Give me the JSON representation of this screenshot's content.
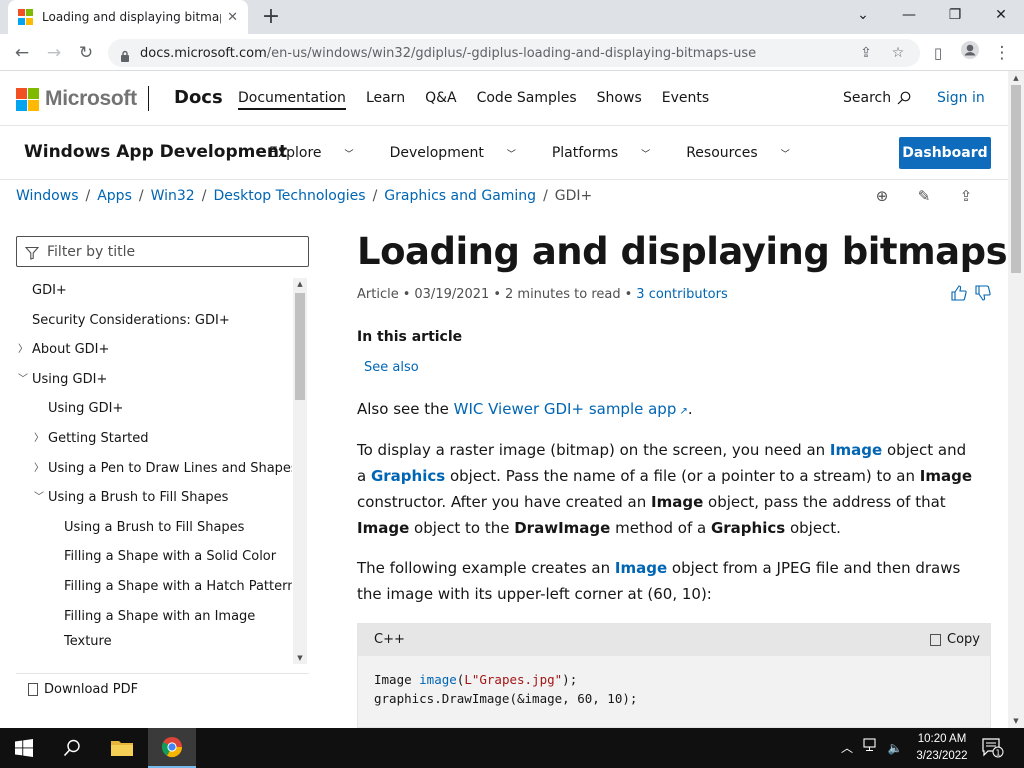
{
  "browser": {
    "tab_title": "Loading and displaying bitmaps",
    "url_host": "docs.microsoft.com",
    "url_path": "/en-us/windows/win32/gdiplus/-gdiplus-loading-and-displaying-bitmaps-use"
  },
  "header": {
    "brand": "Microsoft",
    "site": "Docs",
    "nav": [
      "Documentation",
      "Learn",
      "Q&A",
      "Code Samples",
      "Shows",
      "Events"
    ],
    "search_label": "Search",
    "signin_label": "Sign in"
  },
  "product": {
    "title": "Windows App Development",
    "nav": [
      "Explore",
      "Development",
      "Platforms",
      "Resources"
    ],
    "dashboard_label": "Dashboard"
  },
  "breadcrumb": [
    "Windows",
    "Apps",
    "Win32",
    "Desktop Technologies",
    "Graphics and Gaming",
    "GDI+"
  ],
  "toc": {
    "filter_placeholder": "Filter by title",
    "items": [
      "GDI+",
      "Security Considerations: GDI+",
      "About GDI+",
      "Using GDI+",
      "Using GDI+",
      "Getting Started",
      "Using a Pen to Draw Lines and Shapes",
      "Using a Brush to Fill Shapes",
      "Using a Brush to Fill Shapes",
      "Filling a Shape with a Solid Color",
      "Filling a Shape with a Hatch Pattern",
      "Filling a Shape with an Image",
      "Texture"
    ],
    "download_pdf": "Download PDF"
  },
  "article": {
    "title": "Loading and displaying bitmaps",
    "meta_type": "Article",
    "meta_date": "03/19/2021",
    "meta_read": "2 minutes to read",
    "meta_contributors": "3 contributors",
    "in_this_article": "In this article",
    "see_also": "See also",
    "p1_prefix": "Also see the ",
    "p1_link": "WIC Viewer GDI+ sample app",
    "p1_suffix": ".",
    "p2": {
      "t1": "To display a raster image (bitmap) on the screen, you need an ",
      "image": "Image",
      "t2": " object and a ",
      "graphics": "Graphics",
      "t3": " object. Pass the name of a file (or a pointer to a stream) to an ",
      "image_b": "Image",
      "t4": " constructor. After you have created an ",
      "image_b2": "Image",
      "t5": " object, pass the address of that ",
      "image_b3": "Image",
      "t6": " object to the ",
      "drawimage": "DrawImage",
      "t7": " method of a ",
      "graphics_b": "Graphics",
      "t8": " object."
    },
    "p3": {
      "t1": "The following example creates an ",
      "image": "Image",
      "t2": " object from a JPEG file and then draws the image with its upper-left corner at (60, 10):"
    },
    "code": {
      "lang": "C++",
      "copy_label": "Copy",
      "l1_a": "Image ",
      "l1_fn": "image",
      "l1_b": "(",
      "l1_str": "L\"Grapes.jpg\"",
      "l1_c": ");",
      "l2": "graphics.DrawImage(&image, 60, 10);"
    }
  },
  "taskbar": {
    "time": "10:20 AM",
    "date": "3/23/2022",
    "notif_count": "1"
  },
  "colors": {
    "ms_red": "#f25022",
    "ms_green": "#7fba00",
    "ms_blue": "#00a4ef",
    "ms_yellow": "#ffb900",
    "link": "#0065b3",
    "dashboard": "#0f6cbd"
  }
}
